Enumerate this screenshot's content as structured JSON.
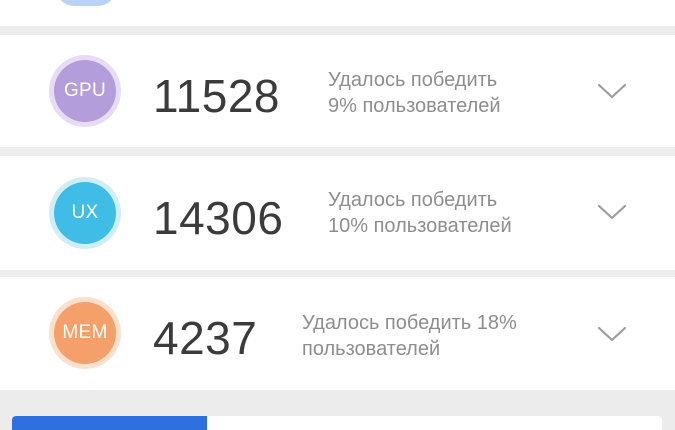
{
  "rows": [
    {
      "badge": "GPU",
      "score": "11528",
      "desc_line1": "Удалось победить",
      "desc_line2": "9% пользователей"
    },
    {
      "badge": "UX",
      "score": "14306",
      "desc_line1": "Удалось победить",
      "desc_line2": "10% пользователей"
    },
    {
      "badge": "MEM",
      "score": "4237",
      "desc_line1": "Удалось победить 18%",
      "desc_line2": "пользователей"
    }
  ],
  "colors": {
    "gpu": "#b39ddb",
    "ux": "#3fbde6",
    "mem": "#f5a06a",
    "bottom_bar": "#2f6fe0"
  },
  "icons": {
    "expand": "chevron-down-icon"
  },
  "bottom_progress": 0.3
}
